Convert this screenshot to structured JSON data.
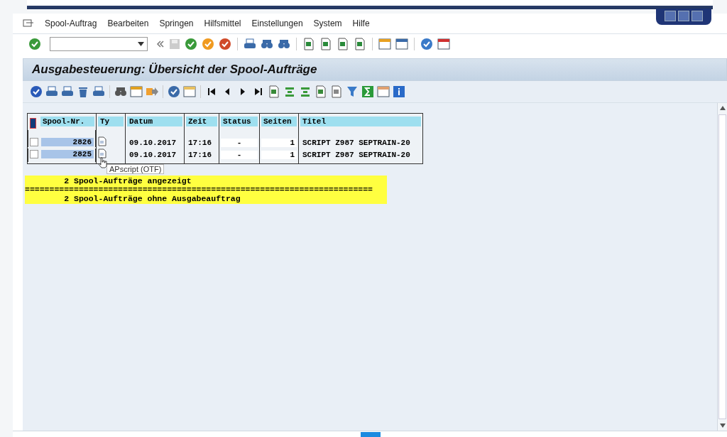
{
  "menu": [
    "Spool-Auftrag",
    "Bearbeiten",
    "Springen",
    "Hilfsmittel",
    "Einstellungen",
    "System",
    "Hilfe"
  ],
  "title": "Ausgabesteuerung: Übersicht der Spool-Aufträge",
  "table": {
    "columns": [
      "Spool-Nr.",
      "Ty",
      "Datum",
      "Zeit",
      "Status",
      "Seiten",
      "Titel"
    ],
    "rows": [
      {
        "selected": false,
        "cells": [
          "2826",
          "",
          "09.10.2017",
          "17:16",
          "-",
          "1",
          "SCRIPT Z987 SEPTRAIN-20"
        ]
      },
      {
        "selected": false,
        "cells": [
          "2825",
          "",
          "09.10.2017",
          "17:16",
          "-",
          "1",
          "SCRIPT Z987 SEPTRAIN-20"
        ]
      }
    ]
  },
  "tooltip": "APscript (OTF)",
  "messages": [
    {
      "kind": "text",
      "text": "        2 Spool-Aufträge angezeigt"
    },
    {
      "kind": "rule",
      "text": "======================================================================="
    },
    {
      "kind": "text",
      "text": "        2 Spool-Aufträge ohne Ausgabeauftrag"
    }
  ]
}
